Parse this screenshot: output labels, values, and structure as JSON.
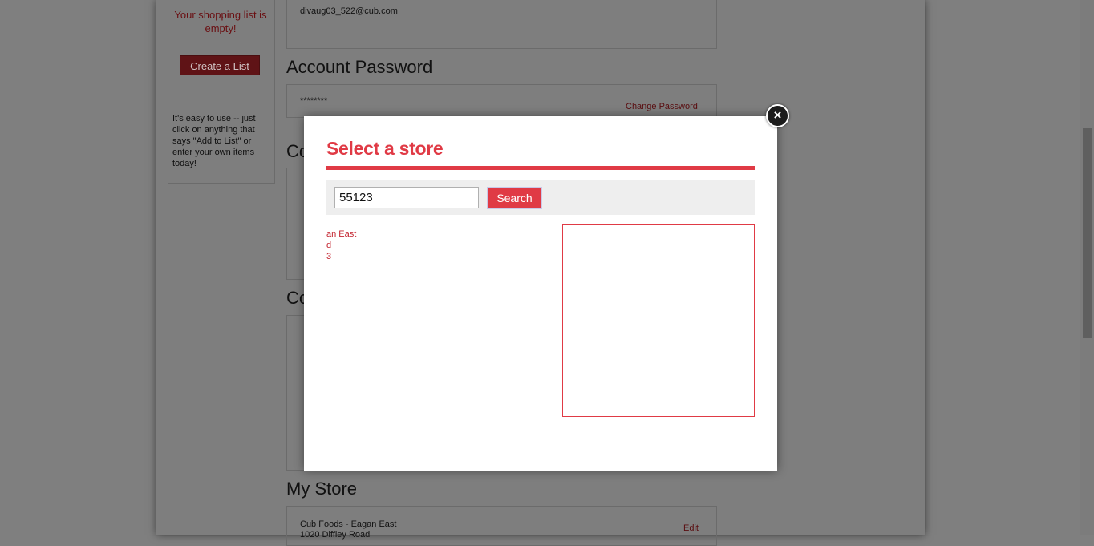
{
  "background_page": {
    "sidebar": {
      "empty_message": "Your shopping list is empty!",
      "create_button": "Create a List",
      "help_text": "It's easy to use -- just click on anything that says \"Add to List\" or enter your own items today!"
    },
    "account": {
      "email": "divaug03_522@cub.com",
      "password_title": "Account Password",
      "password_mask": "********",
      "change_password_link": "Change Password",
      "section3_title_partial": "Co",
      "section4_title_partial": "Co"
    },
    "my_store": {
      "title": "My Store",
      "store_name": "Cub Foods - Eagan East",
      "store_address_partial": "1020 Diffley Road",
      "edit_link": "Edit"
    }
  },
  "modal": {
    "title": "Select a store",
    "zip_value": "55123",
    "search_button": "Search",
    "result_lines": [
      "an East",
      "d",
      "3"
    ],
    "close_label": "×"
  },
  "colors": {
    "accent": "#e03a45",
    "overlay": "#7f7f7f"
  }
}
